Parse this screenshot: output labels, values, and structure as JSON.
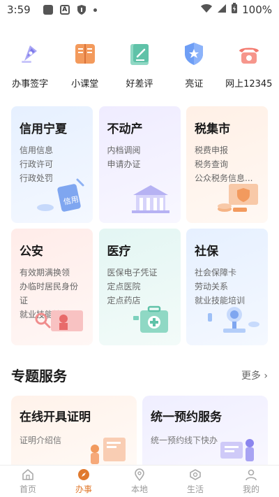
{
  "status": {
    "time": "3:59",
    "battery": "100%"
  },
  "quick": [
    {
      "label": "办事签字",
      "icon": "pen-icon"
    },
    {
      "label": "小课堂",
      "icon": "book-icon"
    },
    {
      "label": "好差评",
      "icon": "review-icon"
    },
    {
      "label": "亮证",
      "icon": "shield-star-icon"
    },
    {
      "label": "网上12345",
      "icon": "phone-icon"
    }
  ],
  "services": [
    {
      "title": "信用宁夏",
      "items": [
        "信用信息",
        "行政许可",
        "行政处罚"
      ],
      "illus_text": "信用"
    },
    {
      "title": "不动产",
      "items": [
        "内档调阅",
        "申请办证"
      ]
    },
    {
      "title": "税集市",
      "items": [
        "税费申报",
        "税务查询",
        "公众税务信息..."
      ]
    },
    {
      "title": "公安",
      "items": [
        "有效期满换领",
        "办临时居民身份证",
        "就业技能培训"
      ]
    },
    {
      "title": "医疗",
      "items": [
        "医保电子凭证",
        "定点医院",
        "定点药店"
      ]
    },
    {
      "title": "社保",
      "items": [
        "社会保障卡",
        "劳动关系",
        "就业技能培训"
      ]
    }
  ],
  "section": {
    "title": "专题服务",
    "more": "更多 ›"
  },
  "specials": [
    {
      "title": "在线开具证明",
      "sub": "证明介绍信"
    },
    {
      "title": "统一预约服务",
      "sub": "统一预约线下快办"
    }
  ],
  "nav": [
    {
      "label": "首页",
      "icon": "home-icon"
    },
    {
      "label": "办事",
      "icon": "compass-icon"
    },
    {
      "label": "本地",
      "icon": "location-icon"
    },
    {
      "label": "生活",
      "icon": "life-icon"
    },
    {
      "label": "我的",
      "icon": "user-icon"
    }
  ],
  "colors": {
    "accent": "#e07a2e"
  }
}
